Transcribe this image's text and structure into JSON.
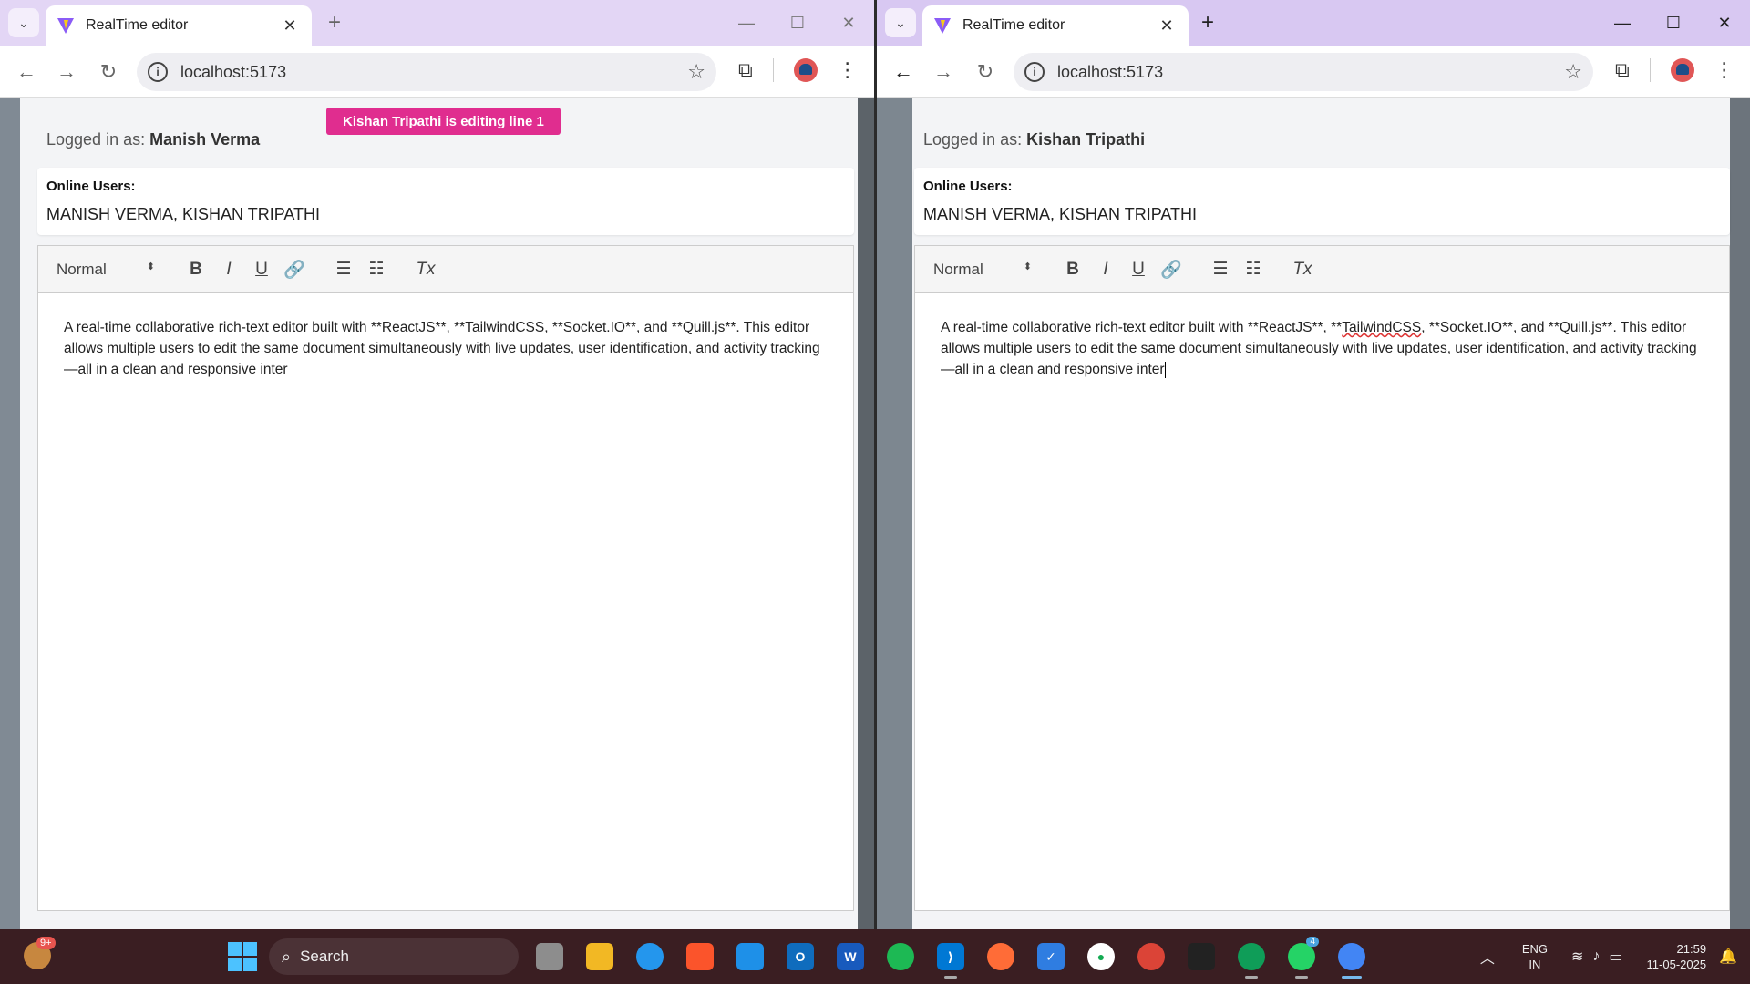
{
  "browser_left": {
    "tab_title": "RealTime editor",
    "url": "localhost:5173",
    "notice": "Kishan Tripathi is editing line 1",
    "logged_label": "Logged in as:",
    "logged_user": "Manish Verma",
    "online_heading": "Online Users:",
    "online_list": "MANISH VERMA, KISHAN TRIPATHI",
    "format_select": "Normal",
    "doc_text": "A real-time collaborative rich-text editor built with **ReactJS**, **TailwindCSS, **Socket.IO**, and **Quill.js**. This editor allows multiple users to edit the same document simultaneously with live updates, user identification, and activity tracking—all in a clean and responsive inter"
  },
  "browser_right": {
    "tab_title": "RealTime editor",
    "url": "localhost:5173",
    "logged_label": "Logged in as:",
    "logged_user": "Kishan Tripathi",
    "online_heading": "Online Users:",
    "online_list": "MANISH VERMA, KISHAN TRIPATHI",
    "format_select": "Normal",
    "doc_text_1": "A real-time collaborative rich-text editor built with **ReactJS**, **",
    "doc_text_spell": "TailwindCSS",
    "doc_text_2": ", **Socket.IO**, and **Quill.js**. This editor allows multiple users to edit the same document simultaneously with live updates, user identification, and activity tracking—all in a clean and responsive inter"
  },
  "taskbar": {
    "search_label": "Search",
    "weather_badge": "9+",
    "whatsapp_count": "4",
    "lang_1": "ENG",
    "lang_2": "IN",
    "time": "21:59",
    "date": "11-05-2025"
  },
  "colors": {
    "notice_bg": "#e02d8f",
    "tabstrip": "#e3d6f5",
    "taskbar": "#3a1e22"
  }
}
